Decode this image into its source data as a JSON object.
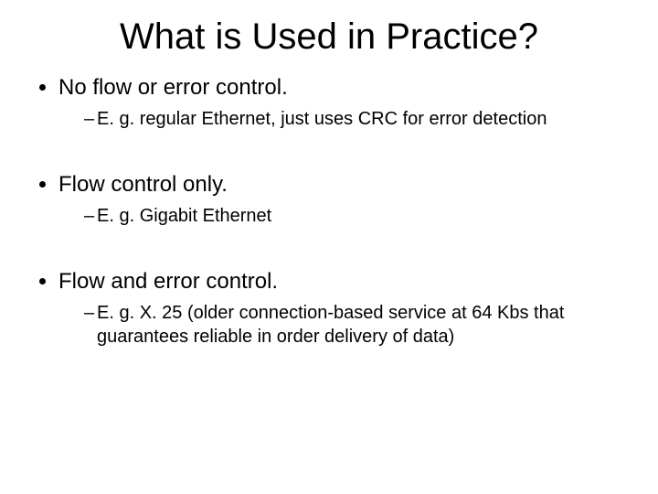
{
  "title": "What is Used in Practice?",
  "bullets": [
    {
      "text": "No flow or error control.",
      "sub": [
        "E. g. regular Ethernet, just uses CRC for error detection"
      ]
    },
    {
      "text": "Flow control only.",
      "sub": [
        "E. g. Gigabit Ethernet"
      ]
    },
    {
      "text": "Flow and error control.",
      "sub": [
        "E. g. X. 25 (older connection-based service at 64 Kbs that guarantees reliable in order delivery of data)"
      ]
    }
  ]
}
